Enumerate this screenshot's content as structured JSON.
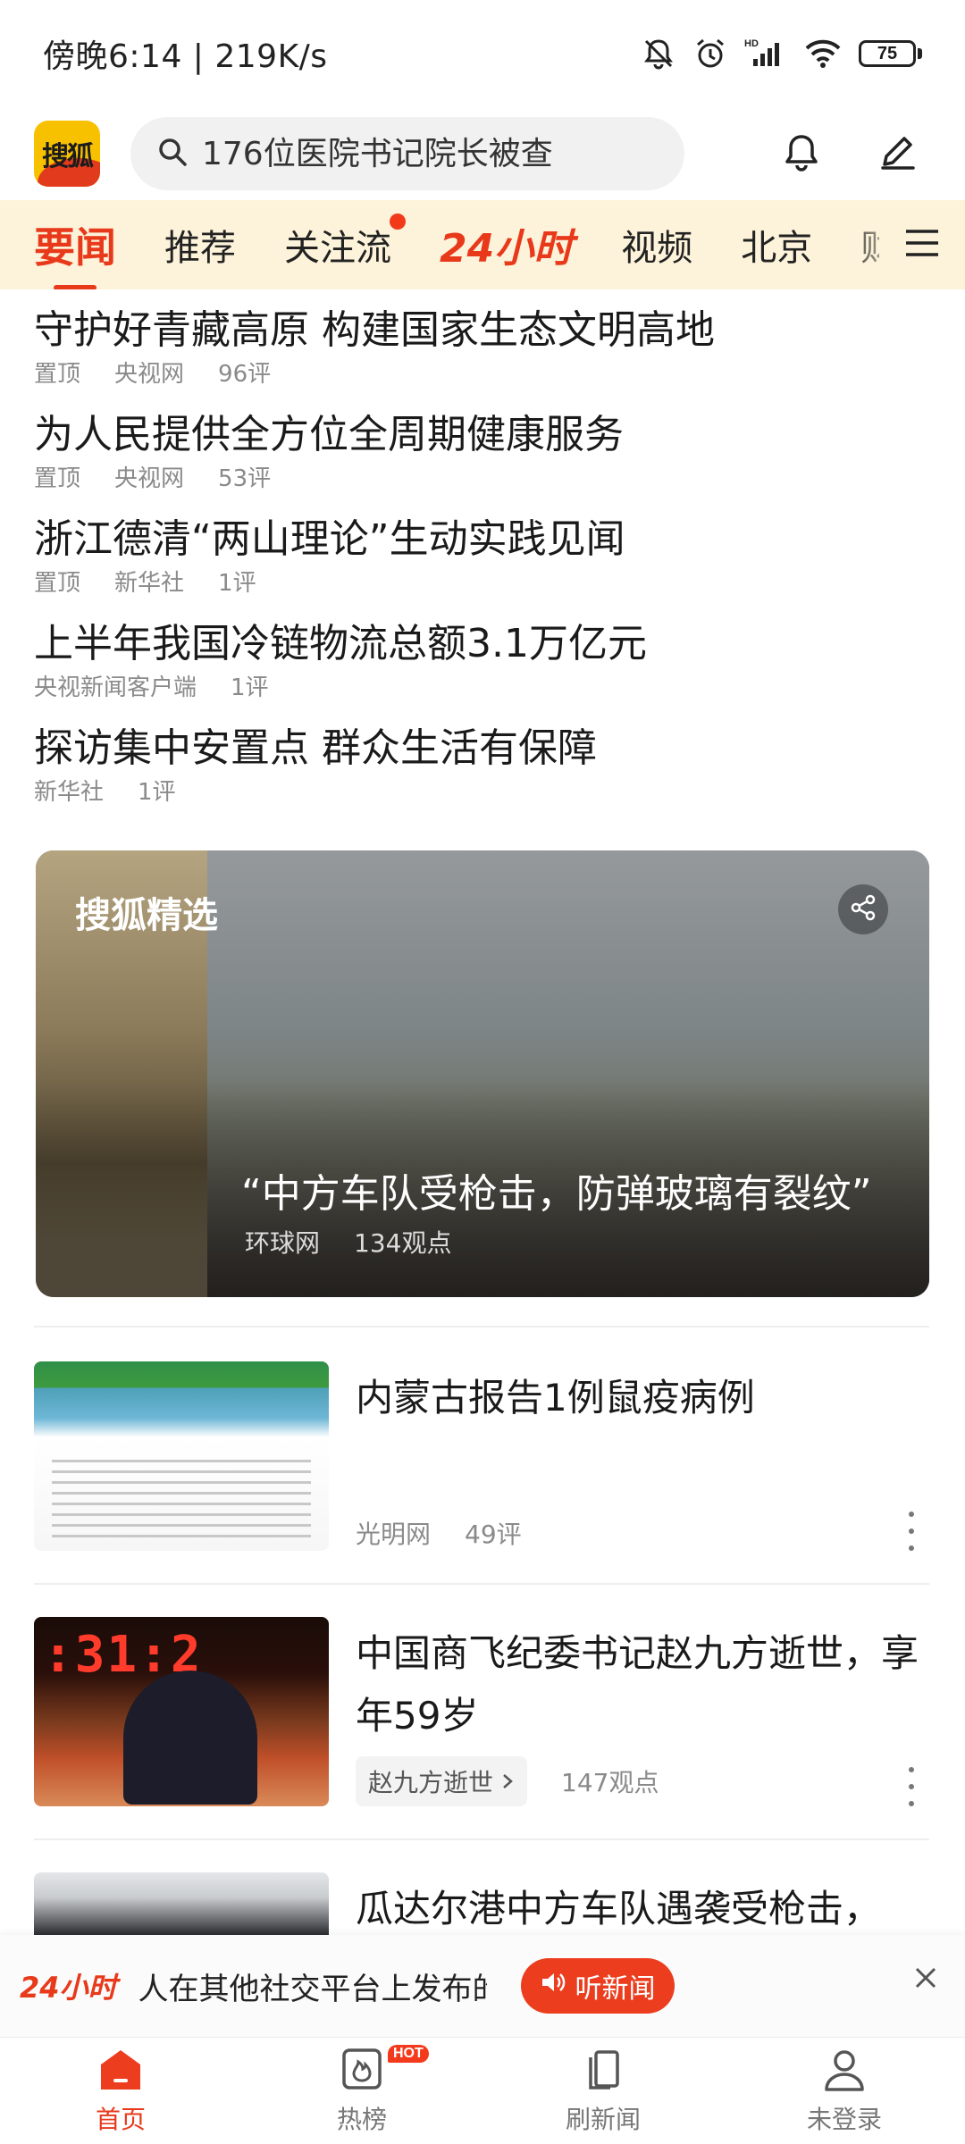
{
  "status_bar": {
    "time_speed": "傍晚6:14 | 219K/s",
    "battery": "75"
  },
  "header": {
    "logo_text": "搜狐",
    "search_placeholder": "176位医院书记院长被查"
  },
  "tabs": [
    "要闻",
    "推荐",
    "关注流",
    "24小时",
    "视频",
    "北京",
    "财"
  ],
  "headlines": [
    {
      "title": "守护好青藏高原 构建国家生态文明高地",
      "meta": [
        "置顶",
        "央视网",
        "96评"
      ]
    },
    {
      "title": "为人民提供全方位全周期健康服务",
      "meta": [
        "置顶",
        "央视网",
        "53评"
      ]
    },
    {
      "title": "浙江德清“两山理论”生动实践见闻",
      "meta": [
        "置顶",
        "新华社",
        "1评"
      ]
    },
    {
      "title": "上半年我国冷链物流总额3.1万亿元",
      "meta": [
        "央视新闻客户端",
        "1评"
      ]
    },
    {
      "title": "探访集中安置点 群众生活有保障",
      "meta": [
        "新华社",
        "1评"
      ]
    }
  ],
  "feature": {
    "brand": "搜狐精选",
    "caption": "“中方车队受枪击，防弹玻璃有裂纹”",
    "source": "环球网",
    "views": "134观点"
  },
  "feed": [
    {
      "title": "内蒙古报告1例鼠疫病例",
      "source": "光明网",
      "comments": "49评"
    },
    {
      "title": "中国商飞纪委书记赵九方逝世，享年59岁",
      "tag": "赵九方逝世",
      "views": "147观点"
    },
    {
      "title": "瓜达尔港中方车队遇袭受枪击，"
    }
  ],
  "news_bar": {
    "brand": "24小时",
    "ticker": "人在其他社交平台上发布的内容。B站已对",
    "listen": "听新闻"
  },
  "bottom_nav": {
    "home": "首页",
    "hot_list": "热榜",
    "hot_badge": "HOT",
    "refresh": "刷新闻",
    "login": "未登录"
  },
  "colors": {
    "accent": "#e8391b",
    "tab_bg": "#fdf3da"
  }
}
